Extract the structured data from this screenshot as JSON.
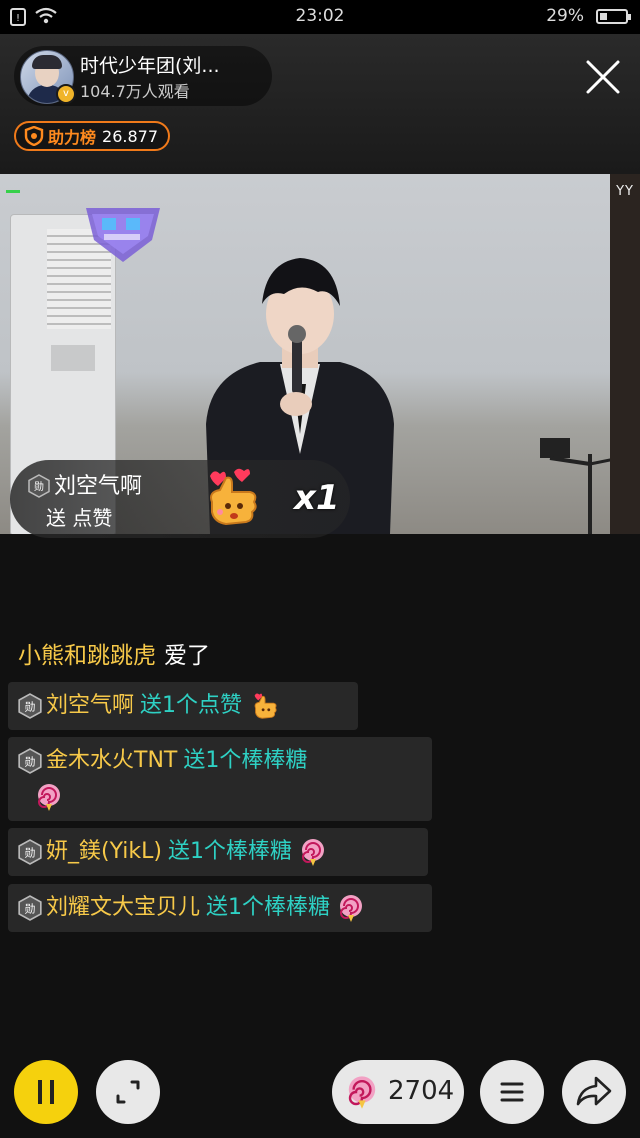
{
  "status_bar": {
    "time": "23:02",
    "battery": "29%",
    "battery_level": 0.29
  },
  "host": {
    "name": "时代少年团(刘...",
    "viewers": "104.7万人观看",
    "verified_mark": "v"
  },
  "rank": {
    "label": "助力榜",
    "value": "26.877"
  },
  "video": {
    "watermark": "YY"
  },
  "gift_banner": {
    "user": "刘空气啊",
    "action": "送 点赞",
    "count": "x1",
    "badge": "勋"
  },
  "chat": {
    "plain": {
      "nick": "小熊和跳跳虎",
      "msg": "爱了"
    },
    "messages": [
      {
        "nick": "刘空气啊",
        "action": "送1个点赞",
        "gift": "like"
      },
      {
        "nick": "金木水火TNT",
        "action": "送1个棒棒糖",
        "gift": "lollipop"
      },
      {
        "nick": "妍_鎂(YikL)",
        "action": "送1个棒棒糖",
        "gift": "lollipop"
      },
      {
        "nick": "刘耀文大宝贝儿",
        "action": "送1个棒棒糖",
        "gift": "lollipop"
      }
    ]
  },
  "bottom_bar": {
    "gift_count": "2704"
  },
  "colors": {
    "accent_yellow": "#f5d10d",
    "nick": "#f7c949",
    "action": "#2ed1c4",
    "rank_orange": "#f07a1a"
  }
}
